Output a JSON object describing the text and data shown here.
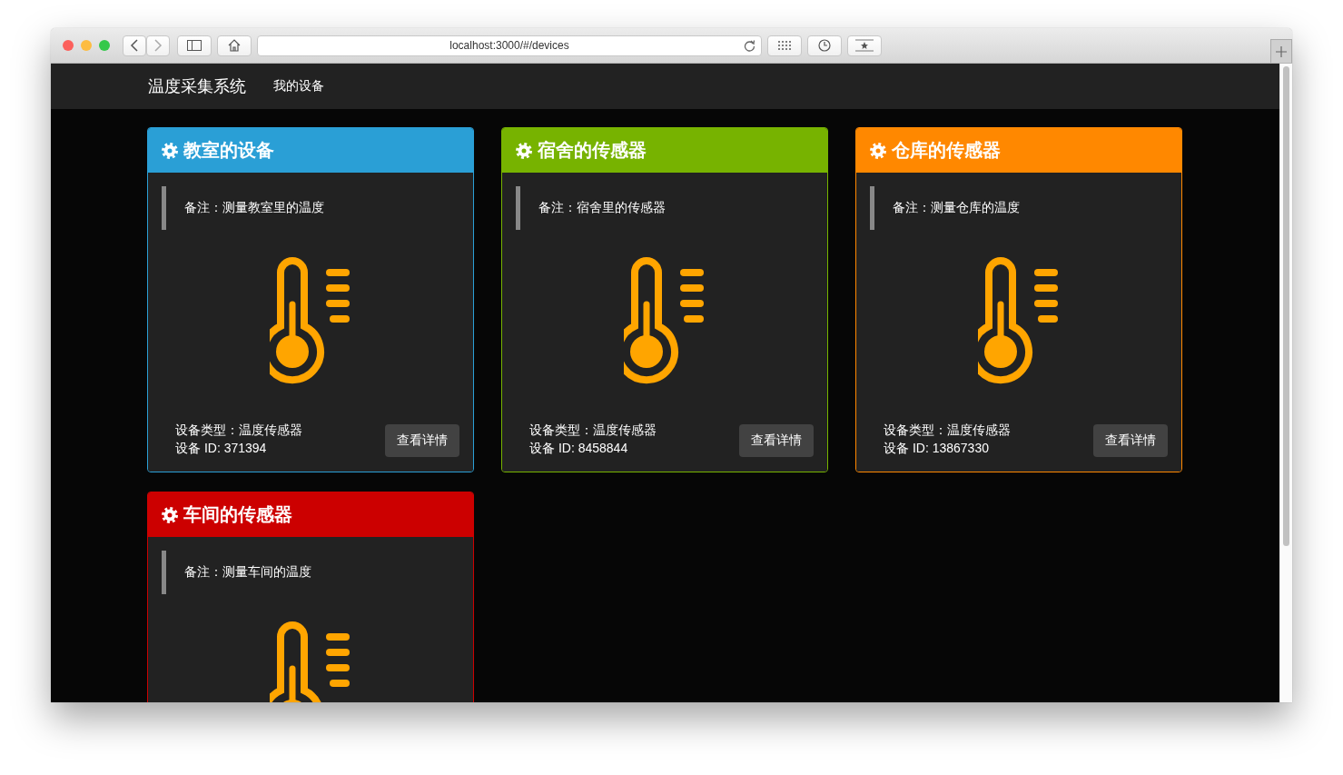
{
  "browser": {
    "url": "localhost:3000/#/devices"
  },
  "navbar": {
    "brand": "温度采集系统",
    "links": [
      {
        "label": "我的设备"
      }
    ]
  },
  "cards": [
    {
      "title": "教室的设备",
      "color": "#2a9fd6",
      "note": "备注：测量教室里的温度",
      "type": "设备类型：温度传感器",
      "device_id": "设备 ID: 371394",
      "button": "查看详情"
    },
    {
      "title": "宿舍的传感器",
      "color": "#77b300",
      "note": "备注：宿舍里的传感器",
      "type": "设备类型：温度传感器",
      "device_id": "设备 ID: 8458844",
      "button": "查看详情"
    },
    {
      "title": "仓库的传感器",
      "color": "#ff8800",
      "note": "备注：测量仓库的温度",
      "type": "设备类型：温度传感器",
      "device_id": "设备 ID: 13867330",
      "button": "查看详情"
    },
    {
      "title": "车间的传感器",
      "color": "#cc0000",
      "note": "备注：测量车间的温度"
    }
  ]
}
